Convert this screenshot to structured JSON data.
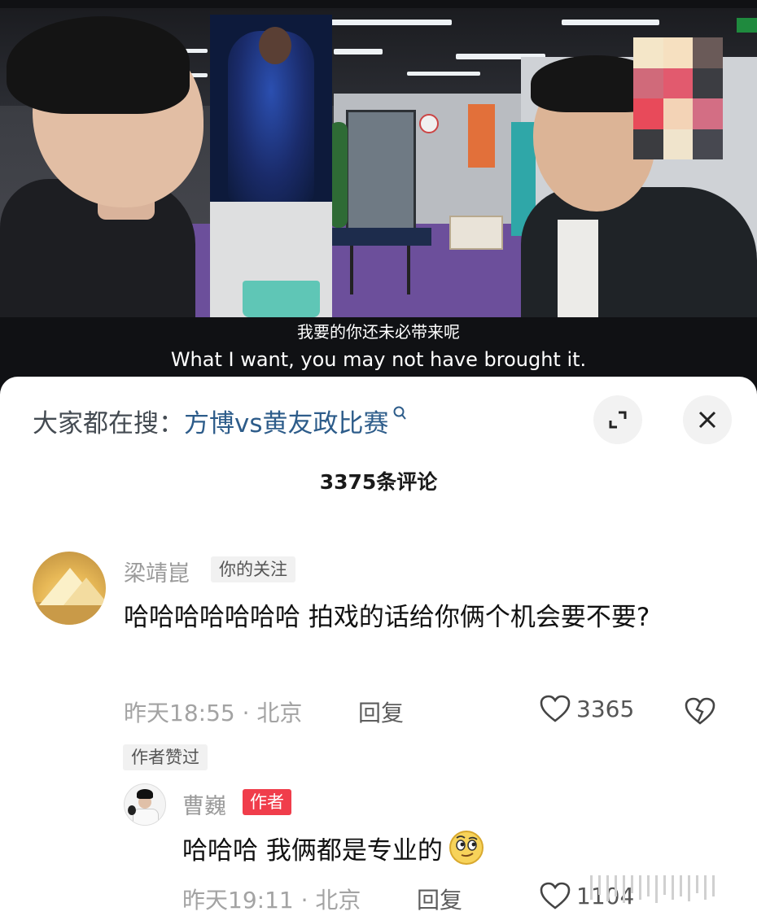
{
  "video": {
    "subtitle_cn": "我要的你还未必带来呢",
    "subtitle_en": "What I want, you may not have brought it."
  },
  "search": {
    "prefix": "大家都在搜：",
    "term": "方博vs黄友政比赛"
  },
  "comments_header": {
    "count_label": "3375条评论"
  },
  "comment": {
    "author": "梁靖崑",
    "follow_tag": "你的关注",
    "text": "哈哈哈哈哈哈哈 拍戏的话给你俩个机会要不要?",
    "time_location": "昨天18:55 · 北京",
    "reply_label": "回复",
    "likes": "3365",
    "author_liked_tag": "作者赞过"
  },
  "reply": {
    "author": "曹巍",
    "author_tag": "作者",
    "text": "哈哈哈 我俩都是专业的",
    "time_location": "昨天19:11 · 北京",
    "reply_label": "回复",
    "likes": "1104"
  },
  "icons": {
    "search_magnifier": "search-icon",
    "expand": "expand-icon",
    "close": "close-icon",
    "like": "heart-icon",
    "dislike": "broken-heart-icon",
    "emoji": "smirk-emoji-icon"
  },
  "colors": {
    "search_term": "#2d5c8a",
    "author_tag_bg": "#f03d4b",
    "meta_text": "#a3a3a3"
  }
}
